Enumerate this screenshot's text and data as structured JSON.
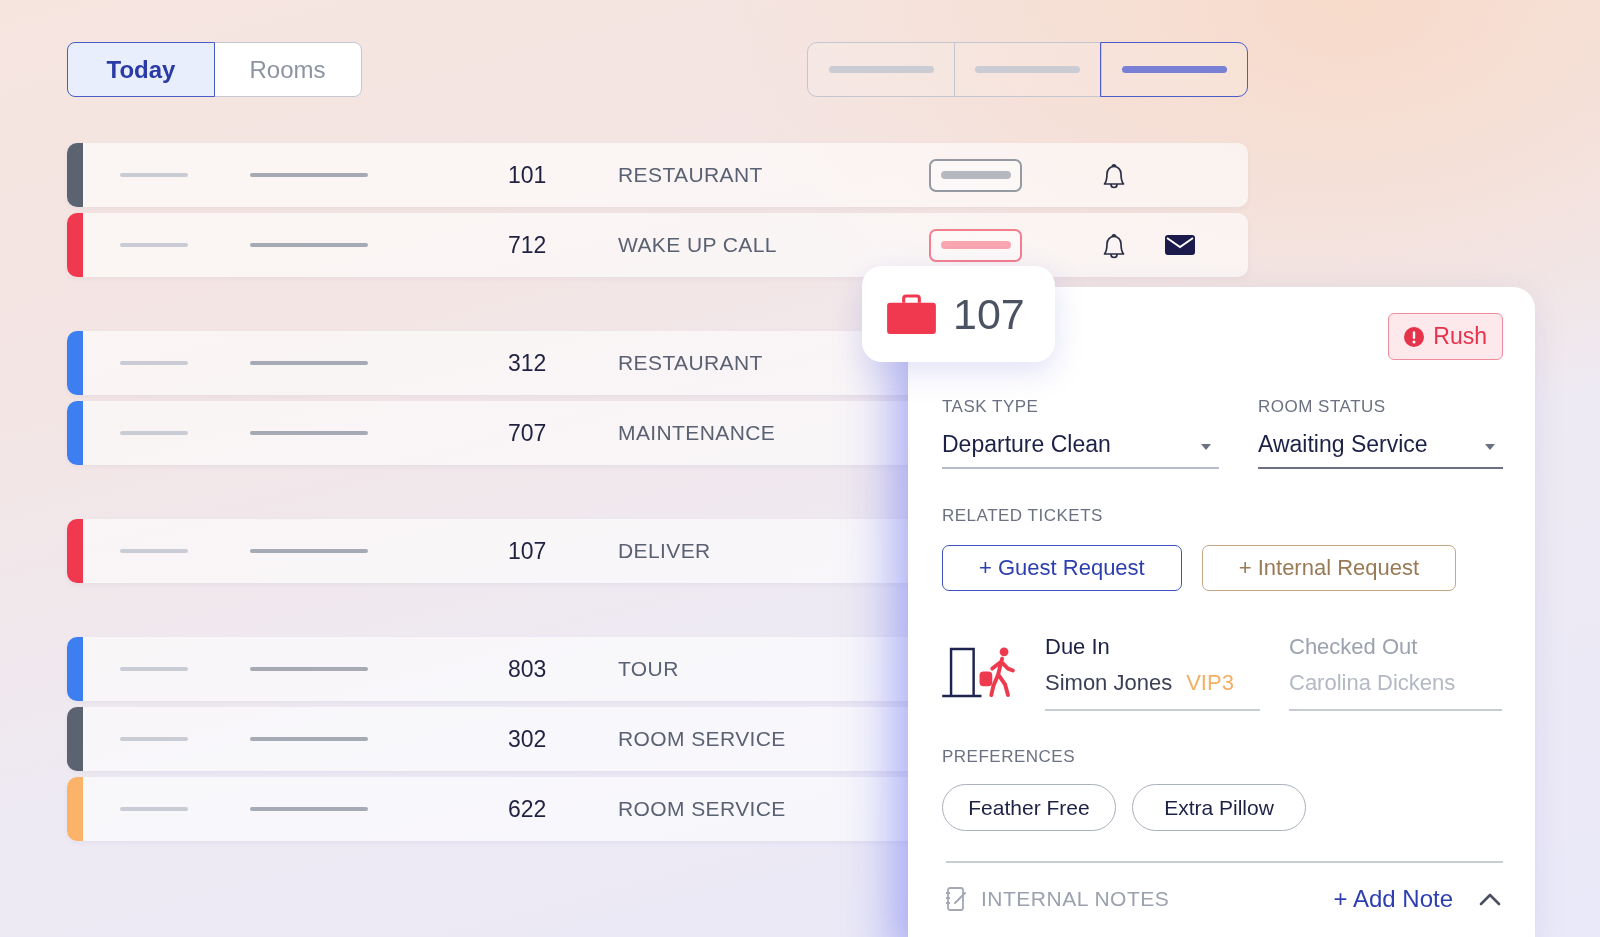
{
  "view_tabs": [
    {
      "label": "Today",
      "selected": true
    },
    {
      "label": "Rooms",
      "selected": false
    }
  ],
  "layout_toggle": [
    {
      "selected": false
    },
    {
      "selected": false
    },
    {
      "selected": true
    }
  ],
  "task_groups": [
    {
      "rows": [
        {
          "room": "101",
          "task": "RESTAURANT",
          "color": "#5b6270",
          "pill": true,
          "bell": true,
          "mail": false
        },
        {
          "room": "712",
          "task": "WAKE UP CALL",
          "color": "#f0384f",
          "pill": true,
          "bell": true,
          "mail": true
        }
      ]
    },
    {
      "rows": [
        {
          "room": "312",
          "task": "RESTAURANT",
          "color": "#3d7ef0"
        },
        {
          "room": "707",
          "task": "MAINTENANCE",
          "color": "#3d7ef0"
        }
      ]
    },
    {
      "rows": [
        {
          "room": "107",
          "task": "DELIVER",
          "color": "#f0384f"
        }
      ]
    },
    {
      "rows": [
        {
          "room": "803",
          "task": "TOUR",
          "color": "#3d7ef0"
        },
        {
          "room": "302",
          "task": "ROOM SERVICE",
          "color": "#5b6270"
        },
        {
          "room": "622",
          "task": "ROOM SERVICE",
          "color": "#fbb36a"
        }
      ]
    }
  ],
  "detail_card": {
    "room": "107",
    "rush": "Rush",
    "fields": [
      {
        "label": "TASK TYPE",
        "value": "Departure Clean"
      },
      {
        "label": "ROOM STATUS",
        "value": "Awaiting Service"
      }
    ],
    "related_label": "RELATED TICKETS",
    "ticket_buttons": [
      {
        "label": "+ Guest Request",
        "kind": "guest"
      },
      {
        "label": "+ Internal Request",
        "kind": "internal"
      }
    ],
    "guests": [
      {
        "status": "Due In",
        "name": "Simon Jones",
        "badge": "VIP3",
        "active": true
      },
      {
        "status": "Checked Out",
        "name": "Carolina Dickens",
        "active": false
      }
    ],
    "preferences_label": "PREFERENCES",
    "preferences": [
      "Feather Free",
      "Extra Pillow"
    ],
    "notes_label": "INTERNAL NOTES",
    "add_note": "+ Add Note",
    "notes_expanded": true
  }
}
